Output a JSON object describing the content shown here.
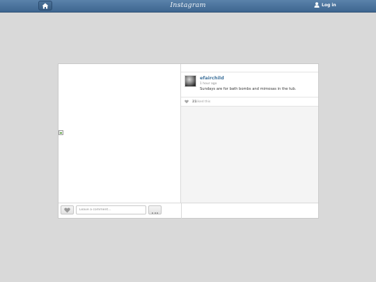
{
  "header": {
    "logo_text": "Instagram",
    "login_label": "Log in"
  },
  "post": {
    "username": "efairchild",
    "time_ago": "1 hour ago",
    "caption": "Sundays are for bath bombs and mimosas in the tub.",
    "likes_count": "21",
    "likes_label": "liked this"
  },
  "comment": {
    "placeholder": "Leave a comment..."
  },
  "colors": {
    "topbar": "#3e6690",
    "username": "#3f729b",
    "background": "#d9d9d9"
  }
}
